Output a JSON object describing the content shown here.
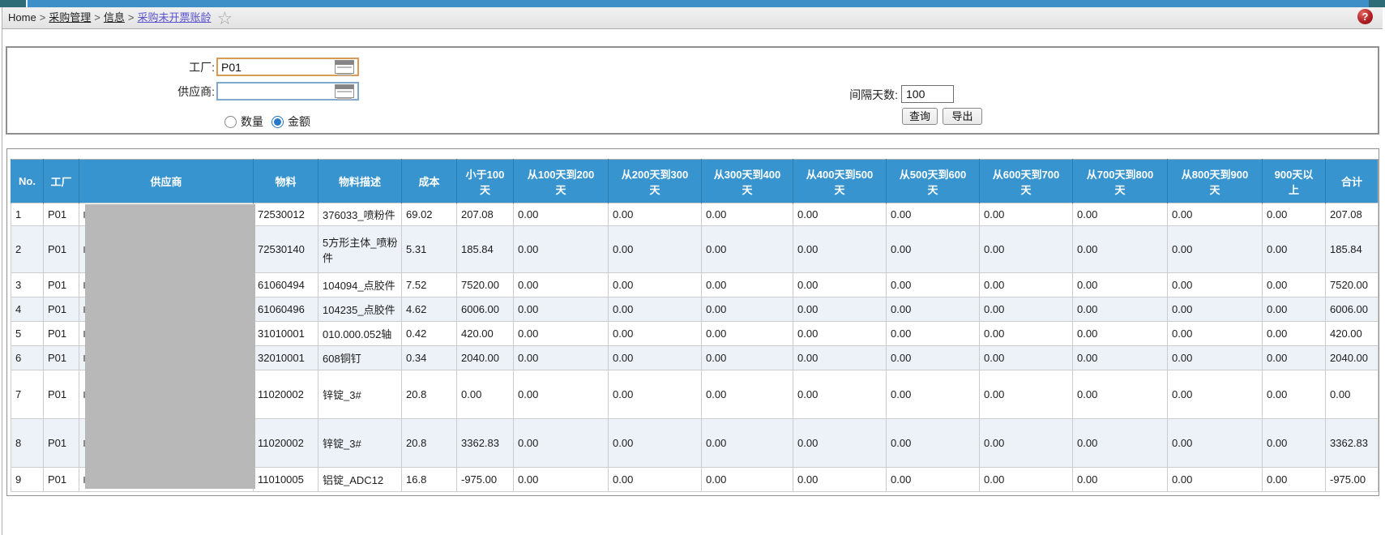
{
  "breadcrumb": {
    "items": [
      "Home",
      "采购管理",
      "信息",
      "采购未开票账龄"
    ],
    "separator": ">",
    "help_glyph": "?"
  },
  "filters": {
    "factory_label": "工厂:",
    "factory_value": "P01",
    "supplier_label": "供应商:",
    "supplier_value": "",
    "radio_options": [
      "数量",
      "金额"
    ],
    "radio_selected": "金额",
    "interval_label": "间隔天数:",
    "interval_value": "100",
    "query_button": "查询",
    "export_button": "导出"
  },
  "table": {
    "columns": [
      "No.",
      "工厂",
      "供应商",
      "物料",
      "物料描述",
      "成本",
      "小于100\n天",
      "从100天到200\n天",
      "从200天到300\n天",
      "从300天到400\n天",
      "从400天到500\n天",
      "从500天到600\n天",
      "从600天到700\n天",
      "从700天到800\n天",
      "从800天到900\n天",
      "900天以\n上",
      "合计"
    ],
    "supplier_redacted": true,
    "rows": [
      [
        "1",
        "P01",
        "",
        "72530012",
        "376033_喷粉件",
        "69.02",
        "207.08",
        "0.00",
        "0.00",
        "0.00",
        "0.00",
        "0.00",
        "0.00",
        "0.00",
        "0.00",
        "0.00",
        "207.08"
      ],
      [
        "2",
        "P01",
        "",
        "72530140",
        "5方形主体_喷粉件",
        "5.31",
        "185.84",
        "0.00",
        "0.00",
        "0.00",
        "0.00",
        "0.00",
        "0.00",
        "0.00",
        "0.00",
        "0.00",
        "185.84"
      ],
      [
        "3",
        "P01",
        "",
        "61060494",
        "104094_点胶件",
        "7.52",
        "7520.00",
        "0.00",
        "0.00",
        "0.00",
        "0.00",
        "0.00",
        "0.00",
        "0.00",
        "0.00",
        "0.00",
        "7520.00"
      ],
      [
        "4",
        "P01",
        "",
        "61060496",
        "104235_点胶件",
        "4.62",
        "6006.00",
        "0.00",
        "0.00",
        "0.00",
        "0.00",
        "0.00",
        "0.00",
        "0.00",
        "0.00",
        "0.00",
        "6006.00"
      ],
      [
        "5",
        "P01",
        "",
        "31010001",
        "010.000.052轴",
        "0.42",
        "420.00",
        "0.00",
        "0.00",
        "0.00",
        "0.00",
        "0.00",
        "0.00",
        "0.00",
        "0.00",
        "0.00",
        "420.00"
      ],
      [
        "6",
        "P01",
        "",
        "32010001",
        "608铜钉",
        "0.34",
        "2040.00",
        "0.00",
        "0.00",
        "0.00",
        "0.00",
        "0.00",
        "0.00",
        "0.00",
        "0.00",
        "0.00",
        "2040.00"
      ],
      [
        "7",
        "P01",
        "",
        "11020002",
        "锌锭_3#",
        "20.8",
        "0.00",
        "0.00",
        "0.00",
        "0.00",
        "0.00",
        "0.00",
        "0.00",
        "0.00",
        "0.00",
        "0.00",
        "0.00"
      ],
      [
        "8",
        "P01",
        "",
        "11020002",
        "锌锭_3#",
        "20.8",
        "3362.83",
        "0.00",
        "0.00",
        "0.00",
        "0.00",
        "0.00",
        "0.00",
        "0.00",
        "0.00",
        "0.00",
        "3362.83"
      ],
      [
        "9",
        "P01",
        "",
        "11010005",
        "铝锭_ADC12",
        "16.8",
        "-975.00",
        "0.00",
        "0.00",
        "0.00",
        "0.00",
        "0.00",
        "0.00",
        "0.00",
        "0.00",
        "0.00",
        "-975.00"
      ]
    ]
  }
}
